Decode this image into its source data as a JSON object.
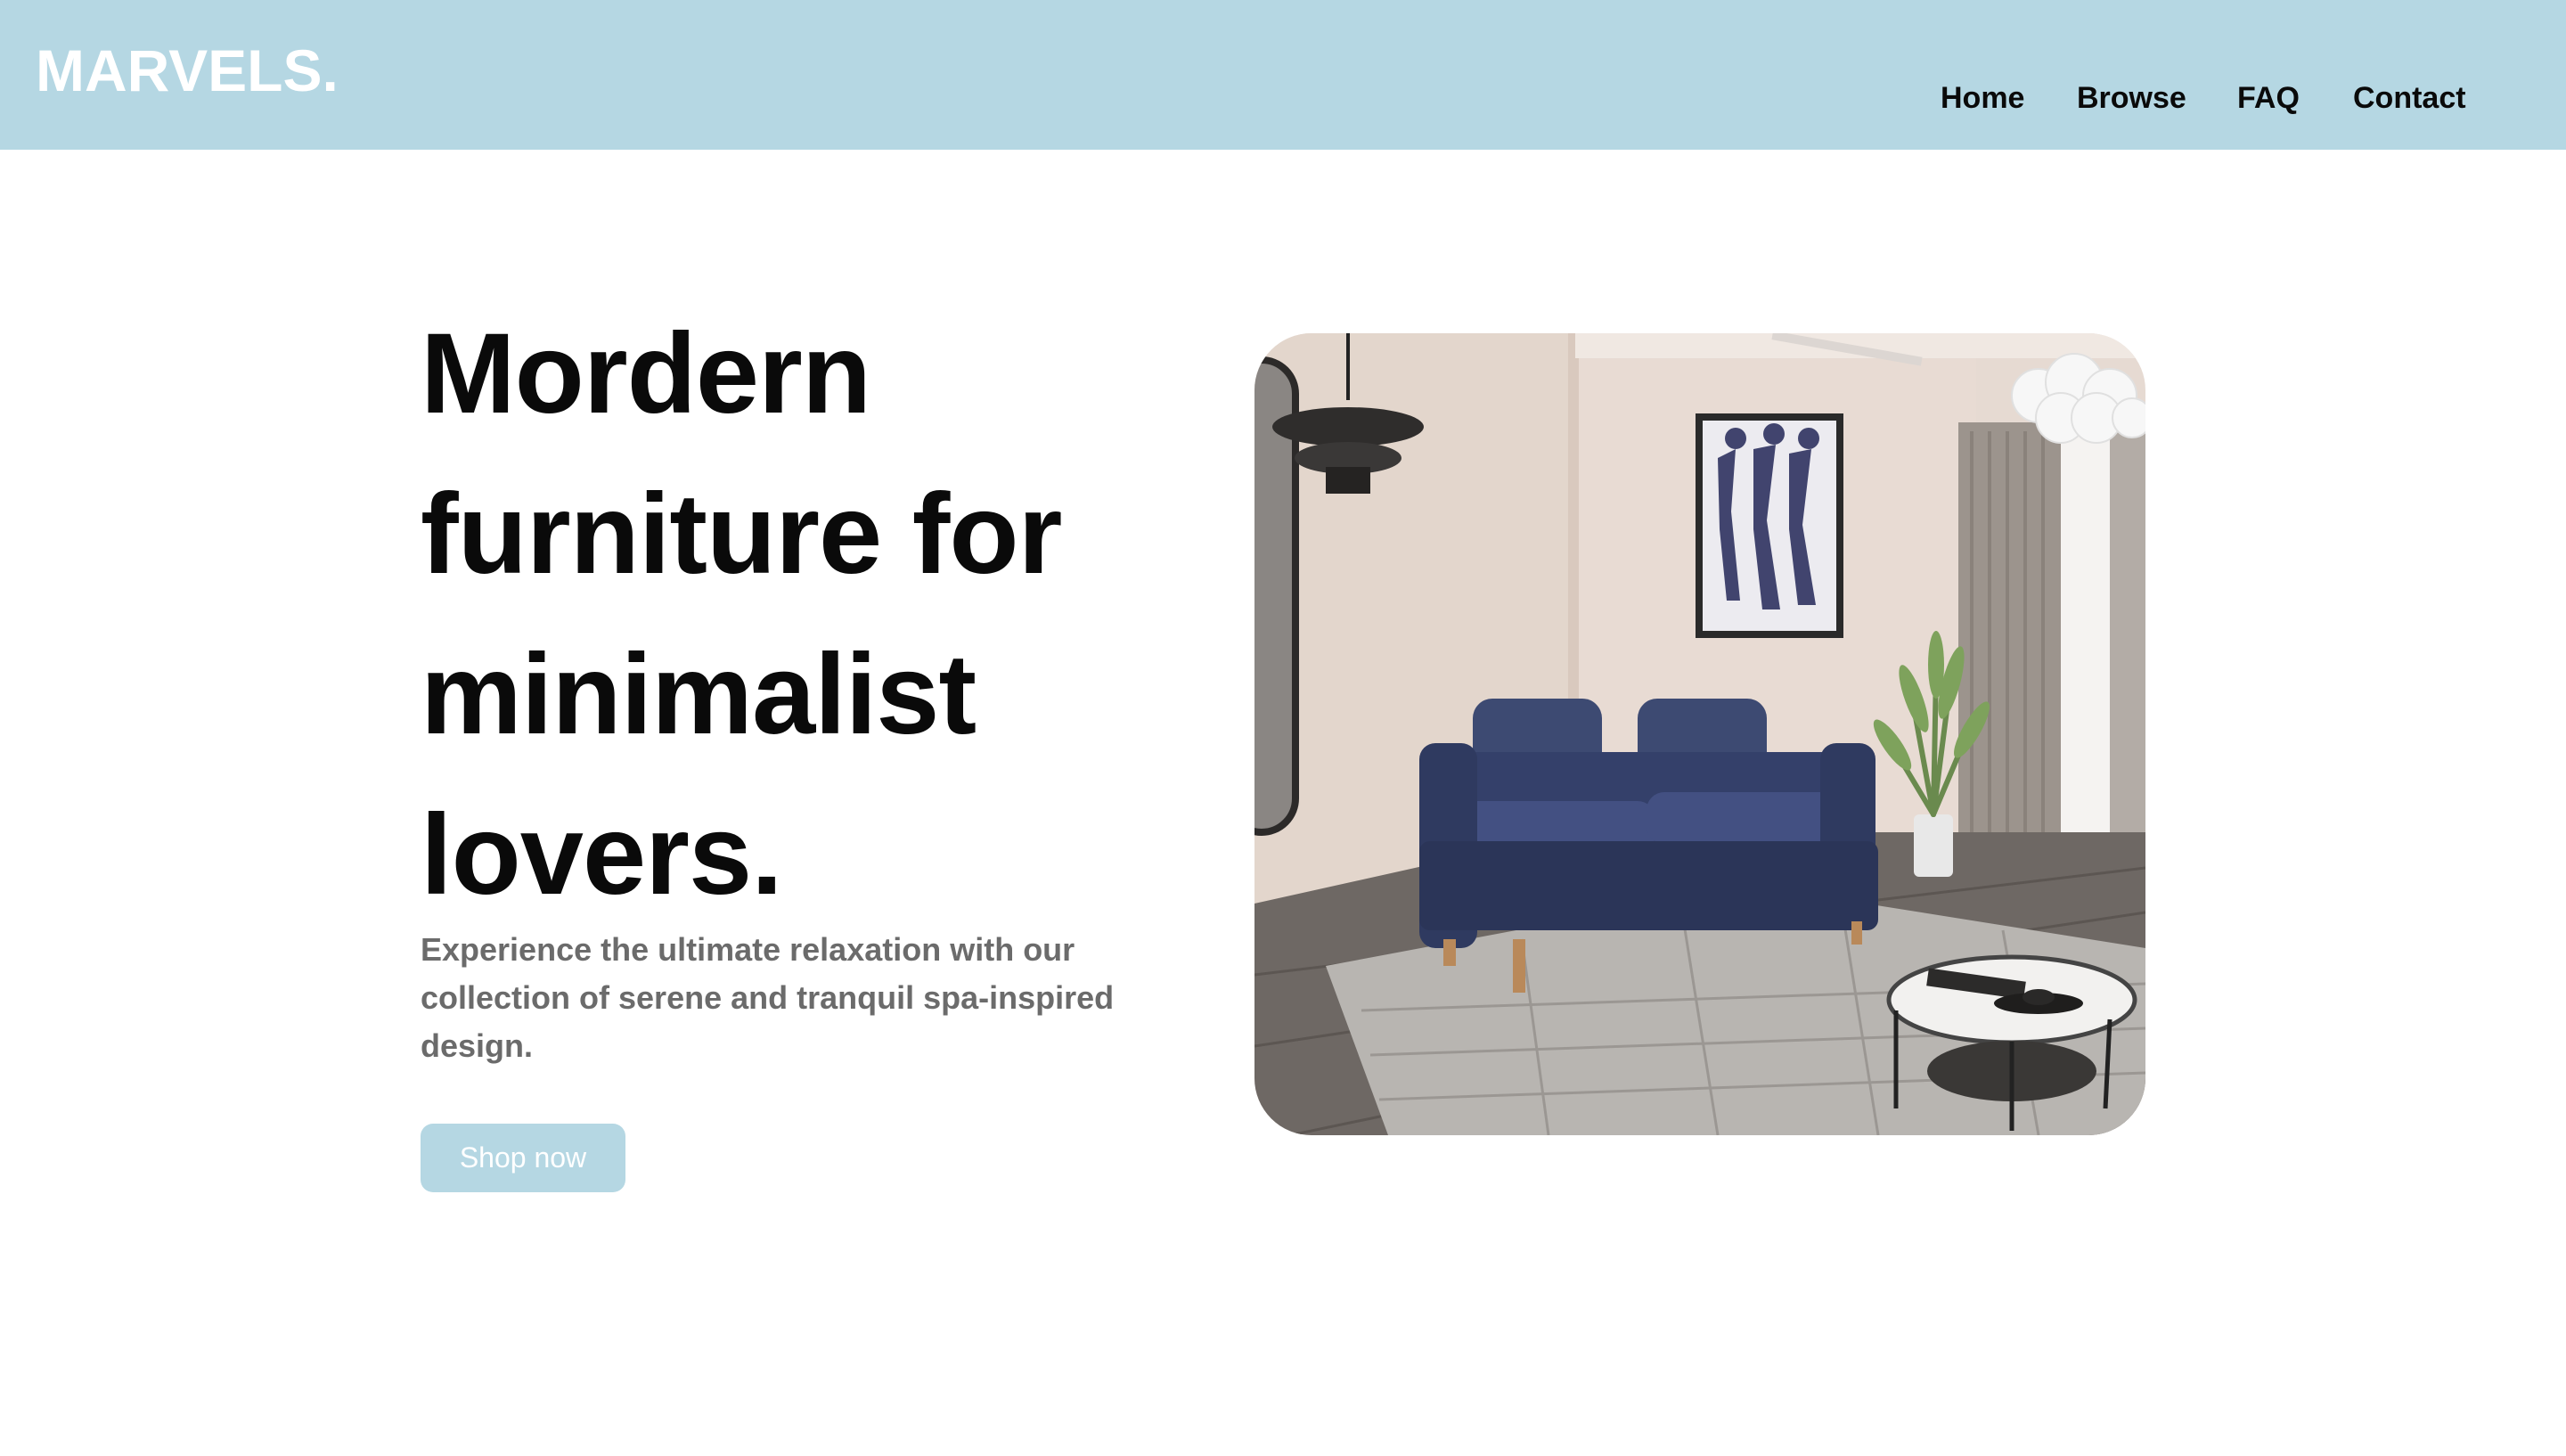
{
  "brand": {
    "logo": "MARVELS."
  },
  "nav": {
    "items": [
      {
        "label": "Home"
      },
      {
        "label": "Browse"
      },
      {
        "label": "FAQ"
      },
      {
        "label": "Contact"
      }
    ]
  },
  "hero": {
    "title_lines": [
      "Mordern",
      "furniture for",
      "minimalist",
      "lovers."
    ],
    "description": "Experience the ultimate relaxation with our collection of serene and tranquil spa-inspired design.",
    "cta_label": "Shop now"
  },
  "colors": {
    "accent": "#b5d7e3",
    "heading": "#0a0a0a",
    "body_text": "#6b6b6b",
    "background": "#ffffff"
  },
  "icons": {
    "hero_image": "living-room-photo"
  }
}
